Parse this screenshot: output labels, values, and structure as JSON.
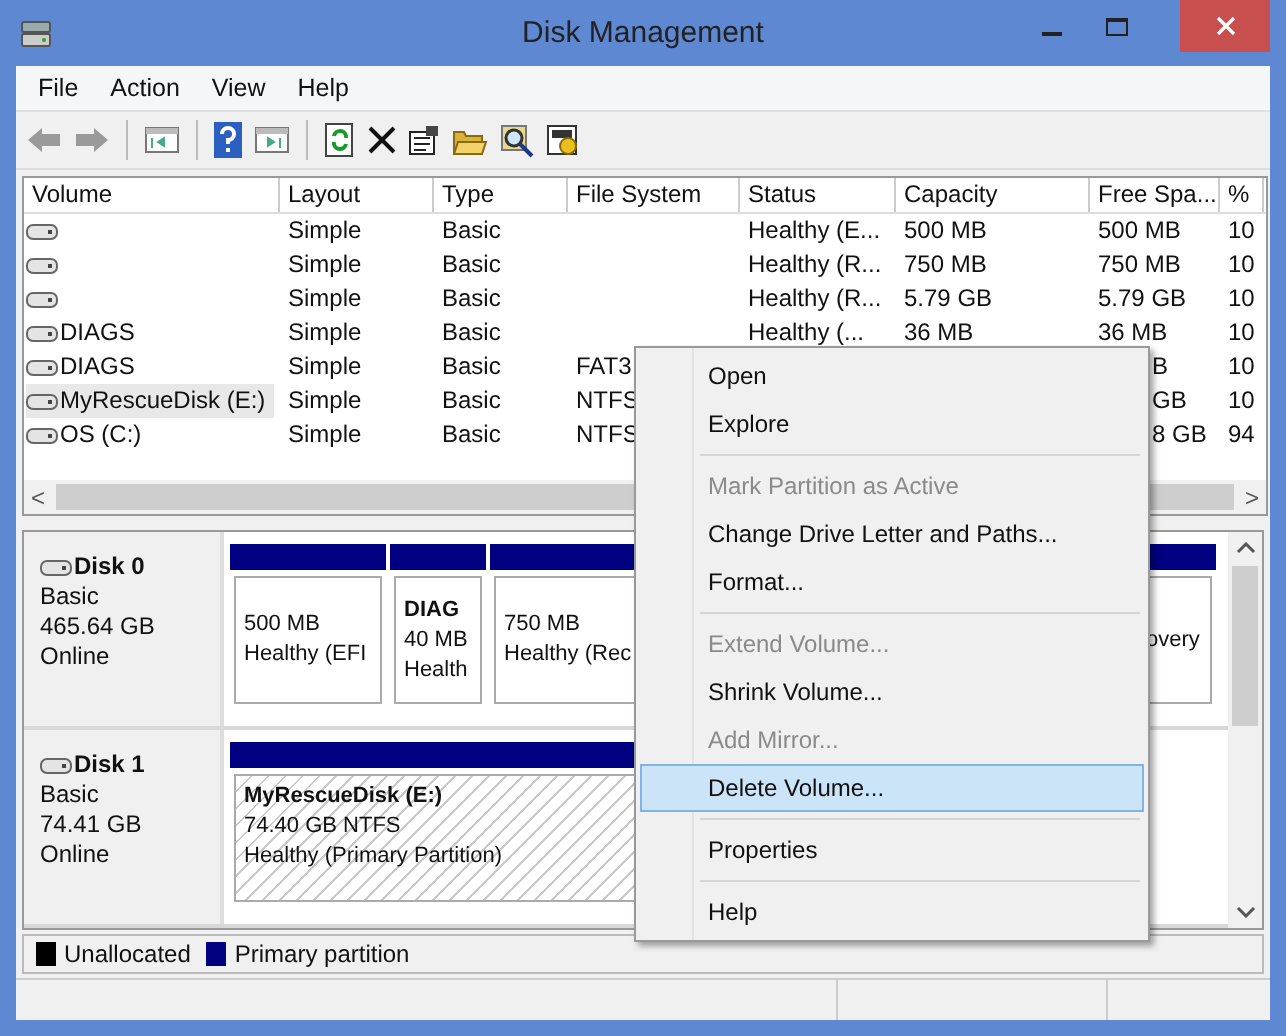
{
  "window": {
    "title": "Disk Management"
  },
  "menu_bar": [
    "File",
    "Action",
    "View",
    "Help"
  ],
  "toolbar": [
    {
      "kind": "back",
      "disabled": true
    },
    {
      "kind": "forward",
      "disabled": true
    },
    {
      "kind": "sep"
    },
    {
      "kind": "tree"
    },
    {
      "kind": "sep"
    },
    {
      "kind": "help"
    },
    {
      "kind": "pane"
    },
    {
      "kind": "sep"
    },
    {
      "kind": "refresh"
    },
    {
      "kind": "delete"
    },
    {
      "kind": "properties"
    },
    {
      "kind": "open"
    },
    {
      "kind": "search"
    },
    {
      "kind": "settings"
    }
  ],
  "table": {
    "columns": [
      "Volume",
      "Layout",
      "Type",
      "File System",
      "Status",
      "Capacity",
      "Free Spa...",
      "%"
    ],
    "rows": [
      {
        "layout": "Simple",
        "type": "Basic",
        "status": "Healthy (E...",
        "capacity": "500 MB",
        "free_space": "500 MB",
        "percent_free": "10",
        "selected": false
      },
      {
        "layout": "Simple",
        "type": "Basic",
        "status": "Healthy (R...",
        "capacity": "750 MB",
        "free_space": "750 MB",
        "percent_free": "10",
        "selected": false
      },
      {
        "layout": "Simple",
        "type": "Basic",
        "status": "Healthy (R...",
        "capacity": "5.79 GB",
        "free_space": "5.79 GB",
        "percent_free": "10",
        "selected": false
      },
      {
        "volume": "DIAGS",
        "layout": "Simple",
        "type": "Basic",
        "status": "Healthy (...",
        "capacity": "36 MB",
        "free_space": "36 MB",
        "percent_free": "10",
        "selected": false
      },
      {
        "volume": "DIAGS",
        "layout": "Simple",
        "type": "Basic",
        "file_system": "FAT3",
        "free_space": "B",
        "free_space_cut": true,
        "percent_free": "10",
        "selected": false
      },
      {
        "volume": "MyRescueDisk (E:)",
        "layout": "Simple",
        "type": "Basic",
        "file_system": "NTFS",
        "free_space": "GB",
        "free_space_cut": true,
        "percent_free": "10",
        "selected": true
      },
      {
        "volume": "OS (C:)",
        "layout": "Simple",
        "type": "Basic",
        "file_system": "NTFS",
        "free_space": "8 GB",
        "free_space_cut": true,
        "percent_free": "94",
        "selected": false
      }
    ]
  },
  "scroll_left": "<",
  "scroll_right": ">",
  "disks": [
    {
      "name": "Disk 0",
      "type": "Basic",
      "size": "465.64 GB",
      "state": "Online",
      "partitions": [
        {
          "size": "500 MB",
          "status": "Healthy (EFI",
          "hatched": false
        },
        {
          "title": "DIAG",
          "size": "40 MB",
          "status": "Health",
          "hatched": false
        },
        {
          "size": "750 MB",
          "status": "Healthy (Rec",
          "hatched": false
        },
        {
          "status": "overy",
          "hatched": false
        }
      ]
    },
    {
      "name": "Disk 1",
      "type": "Basic",
      "size": "74.41 GB",
      "state": "Online",
      "partitions": [
        {
          "title": "MyRescueDisk  (E:)",
          "size": "74.40 GB NTFS",
          "status": "Healthy (Primary Partition)",
          "hatched": true
        }
      ]
    }
  ],
  "legend": [
    {
      "label": "Unallocated",
      "color": "#000000"
    },
    {
      "label": "Primary partition",
      "color": "#000080"
    }
  ],
  "context_menu": [
    {
      "kind": "item",
      "label": "Open",
      "disabled": false,
      "selected": false
    },
    {
      "kind": "item",
      "label": "Explore",
      "disabled": false,
      "selected": false
    },
    {
      "kind": "separator"
    },
    {
      "kind": "item",
      "label": "Mark Partition as Active",
      "disabled": true,
      "selected": false
    },
    {
      "kind": "item",
      "label": "Change Drive Letter and Paths...",
      "disabled": false,
      "selected": false
    },
    {
      "kind": "item",
      "label": "Format...",
      "disabled": false,
      "selected": false
    },
    {
      "kind": "separator"
    },
    {
      "kind": "item",
      "label": "Extend Volume...",
      "disabled": true,
      "selected": false
    },
    {
      "kind": "item",
      "label": "Shrink Volume...",
      "disabled": false,
      "selected": false
    },
    {
      "kind": "item",
      "label": "Add Mirror...",
      "disabled": true,
      "selected": false
    },
    {
      "kind": "item",
      "label": "Delete Volume...",
      "disabled": false,
      "selected": true
    },
    {
      "kind": "separator"
    },
    {
      "kind": "item",
      "label": "Properties",
      "disabled": false,
      "selected": false
    },
    {
      "kind": "separator"
    },
    {
      "kind": "item",
      "label": "Help",
      "disabled": false,
      "selected": false
    }
  ]
}
